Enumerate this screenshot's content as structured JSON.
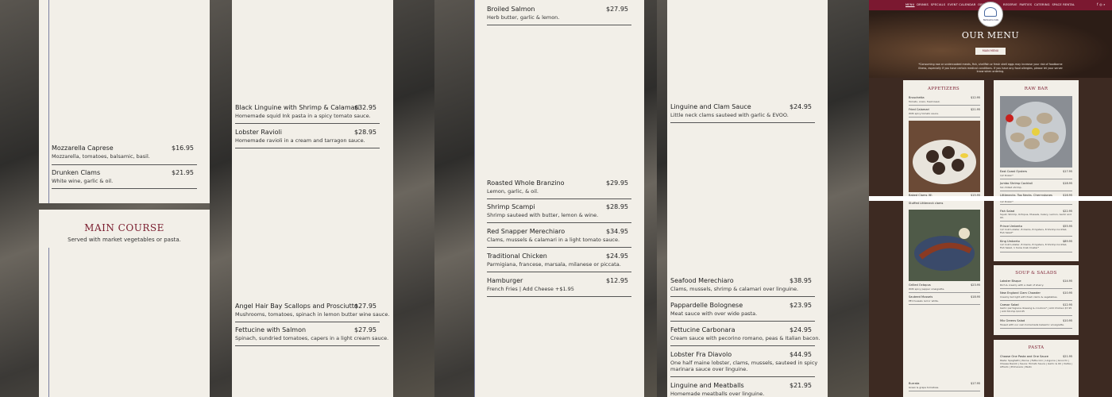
{
  "panel1": {
    "items": [
      {
        "name": "Mozzarella Caprese",
        "price": "$16.95",
        "desc": "Mozzarella, tomatoes, balsamic, basil."
      },
      {
        "name": "Drunken Clams",
        "price": "$21.95",
        "desc": "White wine, garlic & oil."
      }
    ],
    "main_course_title": "MAIN COURSE",
    "main_course_subtitle": "Served with market vegetables or pasta."
  },
  "panel2": {
    "items_top": [
      {
        "name": "Black Linguine with Shrimp & Calamari",
        "price": "$32.95",
        "desc": "Homemade squid Ink pasta in a spicy tomato sauce."
      },
      {
        "name": "Lobster Ravioli",
        "price": "$28.95",
        "desc": "Homemade ravioli in a cream and tarragon sauce."
      }
    ],
    "items_bottom": [
      {
        "name": "Angel Hair Bay Scallops and Prosciutto",
        "price": "$27.95",
        "desc": "Mushrooms, tomatoes, spinach in lemon butter wine sauce."
      },
      {
        "name": "Fettucine with Salmon",
        "price": "$27.95",
        "desc": "Spinach, sundried tomatoes, capers in a light cream sauce."
      }
    ]
  },
  "panel3": {
    "items_top": [
      {
        "name": "Broiled Salmon",
        "price": "$27.95",
        "desc": "Herb butter, garlic & lemon."
      }
    ],
    "items_bottom": [
      {
        "name": "Roasted Whole Branzino",
        "price": "$29.95",
        "desc": "Lemon, garlic, & oil."
      },
      {
        "name": "Shrimp Scampi",
        "price": "$28.95",
        "desc": "Shrimp sauteed with butter, lemon & wine."
      },
      {
        "name": "Red Snapper Merechiaro",
        "price": "$34.95",
        "desc": "Clams, mussels & calamari in a light tomato sauce."
      },
      {
        "name": "Traditional Chicken",
        "price": "$24.95",
        "desc": "Parmigiana, francese, marsala, milanese or piccata."
      },
      {
        "name": "Hamburger",
        "price": "$12.95",
        "desc": "French Fries | Add Cheese +$1.95"
      }
    ]
  },
  "panel4": {
    "items_top": [
      {
        "name": "Linguine and Clam Sauce",
        "price": "$24.95",
        "desc": "Little neck clams sauteed with garlic & EVOO."
      }
    ],
    "items_bottom": [
      {
        "name": "Seafood Merechiaro",
        "price": "$38.95",
        "desc": "Clams, mussels, shrimp & calamari over linguine."
      },
      {
        "name": "Pappardelle Bolognese",
        "price": "$23.95",
        "desc": "Meat sauce with over wide pasta."
      },
      {
        "name": "Fettucine Carbonara",
        "price": "$24.95",
        "desc": "Cream sauce with pecorino romano, peas & Italian bacon."
      },
      {
        "name": "Lobster Fra Diavolo",
        "price": "$44.95",
        "desc": "One half maine lobster, clams, mussels, sauteed in spicy",
        "desc2": "marinara sauce over linguine."
      },
      {
        "name": "Linguine and Meatballs",
        "price": "$21.95",
        "desc": "Homemade meatballs over linguine."
      }
    ]
  },
  "site": {
    "nav_left": [
      "MENU",
      "DRINKS",
      "SPECIALS",
      "EVENT CALENDAR",
      "ORDER"
    ],
    "nav_right": [
      "RESERVE",
      "PARTIES",
      "CATERING",
      "SPACE RENTAL"
    ],
    "logo_text": "Bellissima Cafe",
    "hero_title": "OUR MENU",
    "button": "MAIN MENU",
    "note": "*Consuming raw or undercooked meats, fish, shellfish or fresh shell eggs may increase your risk of foodborne illness, especially if you have certain medical conditions. If you have any food allergies, please let your server know when ordering.",
    "appetizers_title": "APPETIZERS",
    "appetizers": [
      {
        "name": "Bruschetta",
        "price": "$12.95",
        "desc": "Tomato, onion, fresh basil."
      },
      {
        "name": "Fried Calamari",
        "price": "$21.95",
        "desc": "With spicy tomato sauce."
      },
      {
        "name": "Baked Clams (6)",
        "price": "$15.95",
        "desc": ""
      },
      {
        "name": "Stuffed Littleneck clams",
        "price": "",
        "desc": ""
      },
      {
        "name": "Grilled Octopus",
        "price": "$23.95",
        "desc": "With spicy pepper vinaigrette."
      },
      {
        "name": "Sauteed Mussels",
        "price": "$18.95",
        "desc": "PEI mussels red or white."
      },
      {
        "name": "Burrata",
        "price": "$17.95",
        "desc": "Green & grape tomatoes."
      }
    ],
    "rawbar_title": "RAW BAR",
    "rawbar": [
      {
        "name": "East Coast Oysters",
        "price": "$17.95",
        "desc": "1/2 Dozen*"
      },
      {
        "name": "Jumbo Shrimp Cocktail",
        "price": "$18.95",
        "desc": "Six chilled shrimp."
      },
      {
        "name": "Littlenecks, Top Necks, Cherrystones",
        "price": "$16.95",
        "desc": "1/2 Dozen*"
      },
      {
        "name": "Fish Salad",
        "price": "$22.95",
        "desc": "Squid, Shrimp, Octopus, Mussels, Celery, Lemon, Garlic and Oil."
      },
      {
        "name": "Prince Umberto",
        "price": "$55.95",
        "desc": "1/2 Cold Lobster, 8 Clams, 8 Oysters, 8 Shrimp Cocktail, Fish Salad*"
      },
      {
        "name": "King Umberto",
        "price": "$89.95",
        "desc": "1/2 Cold Lobster, 8 Clams, 8 Oysters, 8 Shrimp Cocktail, Fish Salad, 1 Snow Crab Cluster*"
      }
    ],
    "soup_title": "SOUP & SALADS",
    "soups": [
      {
        "name": "Lobster Bisque",
        "price": "$14.95",
        "desc": "Rich & creamy with a dash of sherry."
      },
      {
        "name": "New England Clam Chowder",
        "price": "$10.95",
        "desc": "Creamy but light with fresh clams & vegetables."
      },
      {
        "name": "Caesar Salad",
        "price": "$12.95",
        "desc": "Garlic parmigiana dressing & croutons* | Add Chicken $7.95 | Add Shrimp $12.95"
      },
      {
        "name": "Mix Greens Salad",
        "price": "$10.95",
        "desc": "Tossed with our own homemade balsamic vinaigrette."
      }
    ],
    "pasta_title": "PASTA",
    "pasta": [
      {
        "name": "Choose One Pasta and One Sauce",
        "price": "$21.95",
        "desc": "Pasta: Spaghetti | Penne | Fettuccini | Linguine | Gnocchi |"
      },
      {
        "name": "",
        "price": "",
        "desc": "Cheese Ravioli | Sauce: Tomato Sauce | Garlic & Oil | Vodka |"
      },
      {
        "name": "",
        "price": "",
        "desc": "Alfredo | Primavera | Pesto"
      }
    ]
  },
  "colors": {
    "accent": "#7a1c2e",
    "card": "#f2efe8"
  },
  "icons": [
    "facebook-icon",
    "instagram-icon",
    "search-icon"
  ]
}
